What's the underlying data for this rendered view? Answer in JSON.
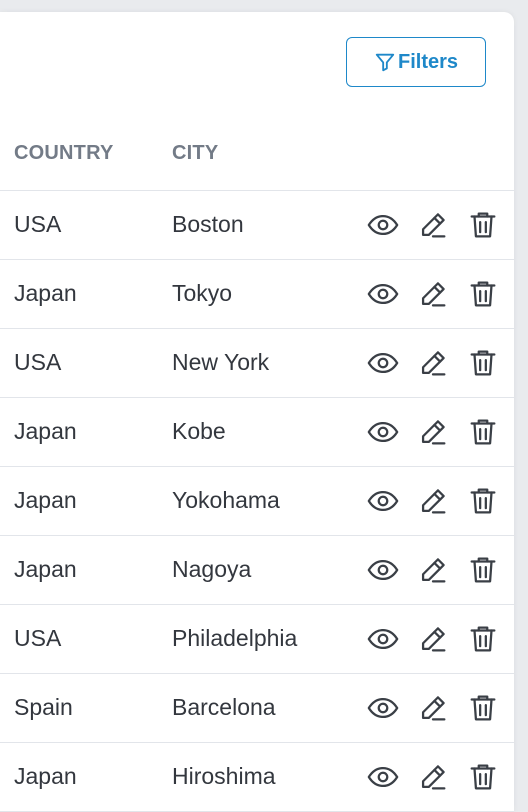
{
  "toolbar": {
    "filters_label": "Filters",
    "filter_icon": "filter-funnel-icon",
    "accent_color": "#1e88c9"
  },
  "table": {
    "columns": [
      "COUNTRY",
      "CITY"
    ],
    "row_actions": [
      "view-icon",
      "edit-icon",
      "delete-icon"
    ],
    "rows": [
      {
        "country": "USA",
        "city": "Boston"
      },
      {
        "country": "Japan",
        "city": "Tokyo"
      },
      {
        "country": "USA",
        "city": "New York"
      },
      {
        "country": "Japan",
        "city": "Kobe"
      },
      {
        "country": "Japan",
        "city": "Yokohama"
      },
      {
        "country": "Japan",
        "city": "Nagoya"
      },
      {
        "country": "USA",
        "city": "Philadelphia"
      },
      {
        "country": "Spain",
        "city": "Barcelona"
      },
      {
        "country": "Japan",
        "city": "Hiroshima"
      }
    ]
  }
}
